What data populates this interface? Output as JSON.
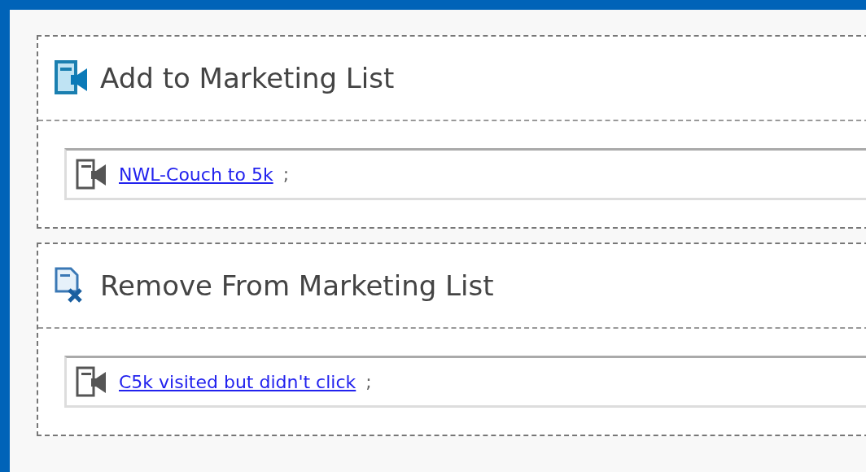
{
  "sections": [
    {
      "kind": "add",
      "title": "Add to Marketing List",
      "items": [
        {
          "label": "NWL-Couch to 5k",
          "separator": ";"
        }
      ]
    },
    {
      "kind": "remove",
      "title": "Remove From Marketing List",
      "items": [
        {
          "label": "C5k visited but didn't click",
          "separator": ";"
        }
      ]
    }
  ]
}
